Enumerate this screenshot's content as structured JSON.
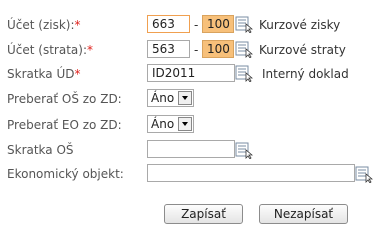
{
  "rows": [
    {
      "label": "Účet (zisk):",
      "required": "*",
      "value": "663",
      "value2": "100",
      "dash": "-",
      "after": "Kurzové zisky"
    },
    {
      "label": "Účet (strata):",
      "required": "*",
      "value": "563",
      "value2": "100",
      "dash": "-",
      "after": "Kurzové straty"
    },
    {
      "label": "Skratka ÚD",
      "required": "*",
      "value": "ID2011",
      "after": "Interný doklad"
    },
    {
      "label": "Preberať OŠ zo ZD:",
      "select": "Áno"
    },
    {
      "label": "Preberať EO zo ZD:",
      "select": "Áno"
    },
    {
      "label": "Skratka OŠ",
      "value": ""
    },
    {
      "label": "Ekonomický objekt:",
      "value": ""
    }
  ],
  "buttons": {
    "save": "Zapísať",
    "cancel": "Nezapísať"
  },
  "icons": {
    "lookup": "lookup-list-icon"
  },
  "colors": {
    "required": "#e0201b",
    "secondary_field": "#f7c07a",
    "focus_border": "#f0a050"
  }
}
